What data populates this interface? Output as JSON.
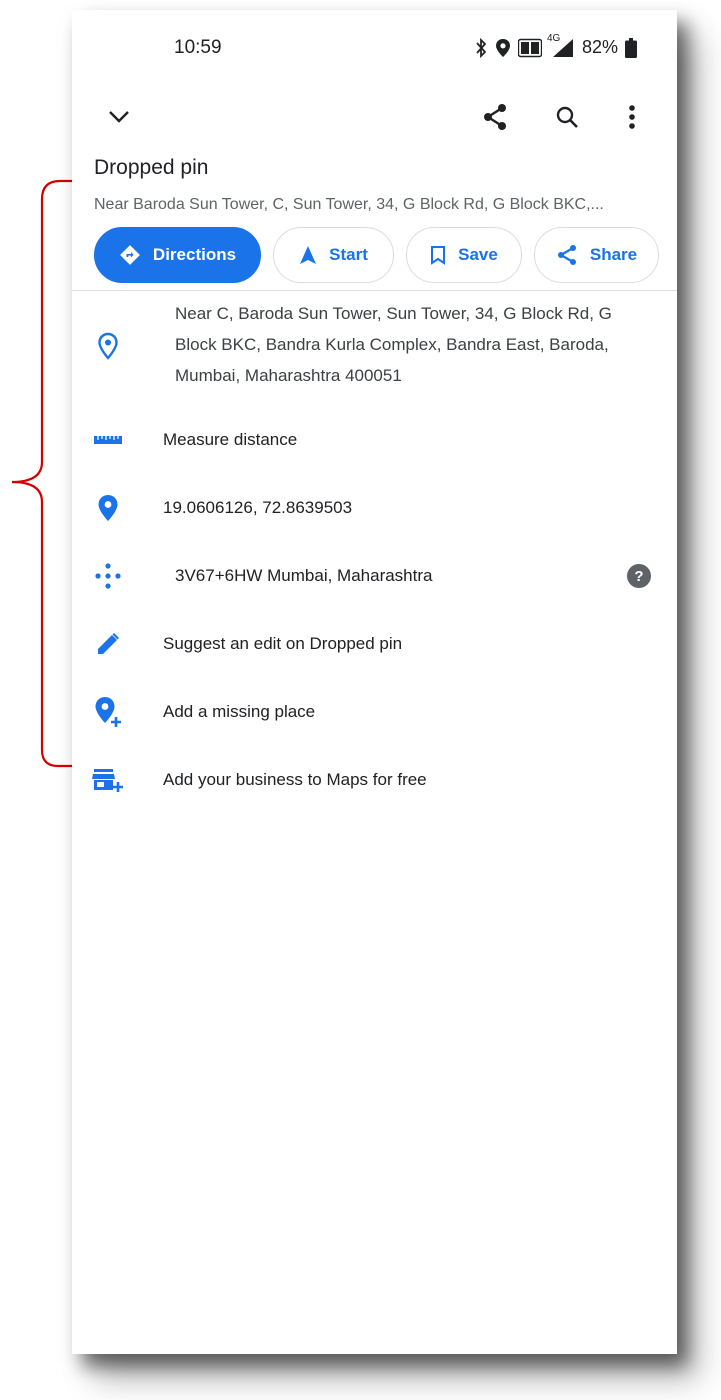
{
  "status_bar": {
    "time": "10:59",
    "network": "4G",
    "battery": "82%",
    "icons": [
      "bluetooth-icon",
      "location-icon",
      "volte-icon",
      "signal-icon",
      "battery-icon"
    ]
  },
  "toolbar": {
    "icons": [
      "chevron-down-icon",
      "share-icon",
      "search-icon",
      "more-vert-icon"
    ]
  },
  "place": {
    "title": "Dropped pin",
    "subtitle": "Near Baroda Sun Tower, C, Sun Tower, 34, G Block Rd, G Block BKC,..."
  },
  "actions": [
    {
      "label": "Directions",
      "icon": "directions-icon"
    },
    {
      "label": "Start",
      "icon": "navigation-arrow-icon"
    },
    {
      "label": "Save",
      "icon": "bookmark-icon"
    },
    {
      "label": "Share",
      "icon": "share-icon"
    }
  ],
  "details": {
    "address": {
      "line1": "Near C, Baroda Sun Tower, Sun Tower, 34, G Block Rd, G",
      "line2": "Block BKC, Bandra Kurla Complex, Bandra East, Baroda,",
      "line3": "Mumbai, Maharashtra 400051"
    },
    "measure": "Measure distance",
    "coordinates": "19.0606126, 72.8639503",
    "plus_code": "3V67+6HW Mumbai, Maharashtra",
    "plus_code_help": "?",
    "suggest_edit": "Suggest an edit on Dropped pin",
    "add_place": "Add a missing place",
    "add_business": "Add your business to Maps for free"
  },
  "colors": {
    "accent": "#1a73e8",
    "annotation": "#d40000"
  }
}
